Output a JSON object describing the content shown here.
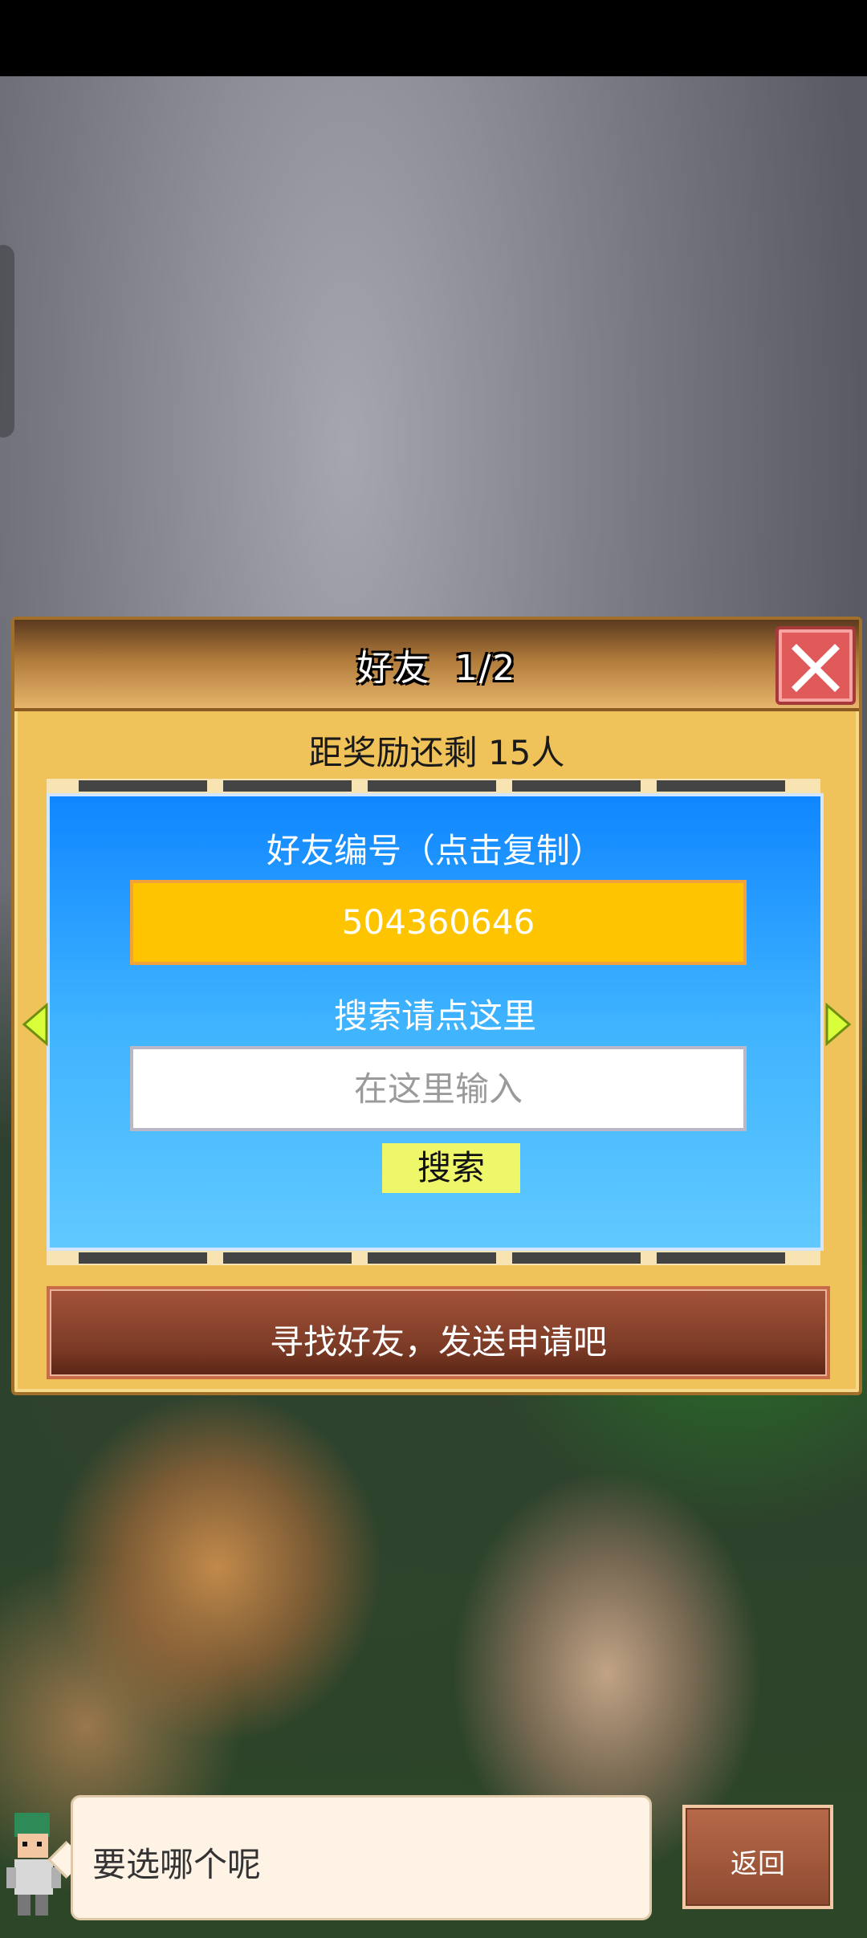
{
  "dialog": {
    "title": "好友",
    "page_indicator": "1/2",
    "reward_info": "距奖励还剩 15人",
    "friend_id_label": "好友编号（点击复制）",
    "friend_id_value": "504360646",
    "search_label": "搜索请点这里",
    "search_placeholder": "在这里输入",
    "search_button": "搜索",
    "banner_text": "寻找好友，发送申请吧"
  },
  "footer": {
    "speech_text": "要选哪个呢",
    "back_button": "返回"
  },
  "colors": {
    "dialog_bg": "#f0c25a",
    "blue_panel": "#0f86ff",
    "id_box": "#ffc400",
    "search_button": "#eef66a",
    "close_button": "#e05a5a",
    "banner": "#7a3a25"
  },
  "icons": {
    "close": "close-icon",
    "prev": "arrow-left-icon",
    "next": "arrow-right-icon",
    "character": "character-avatar-icon"
  }
}
